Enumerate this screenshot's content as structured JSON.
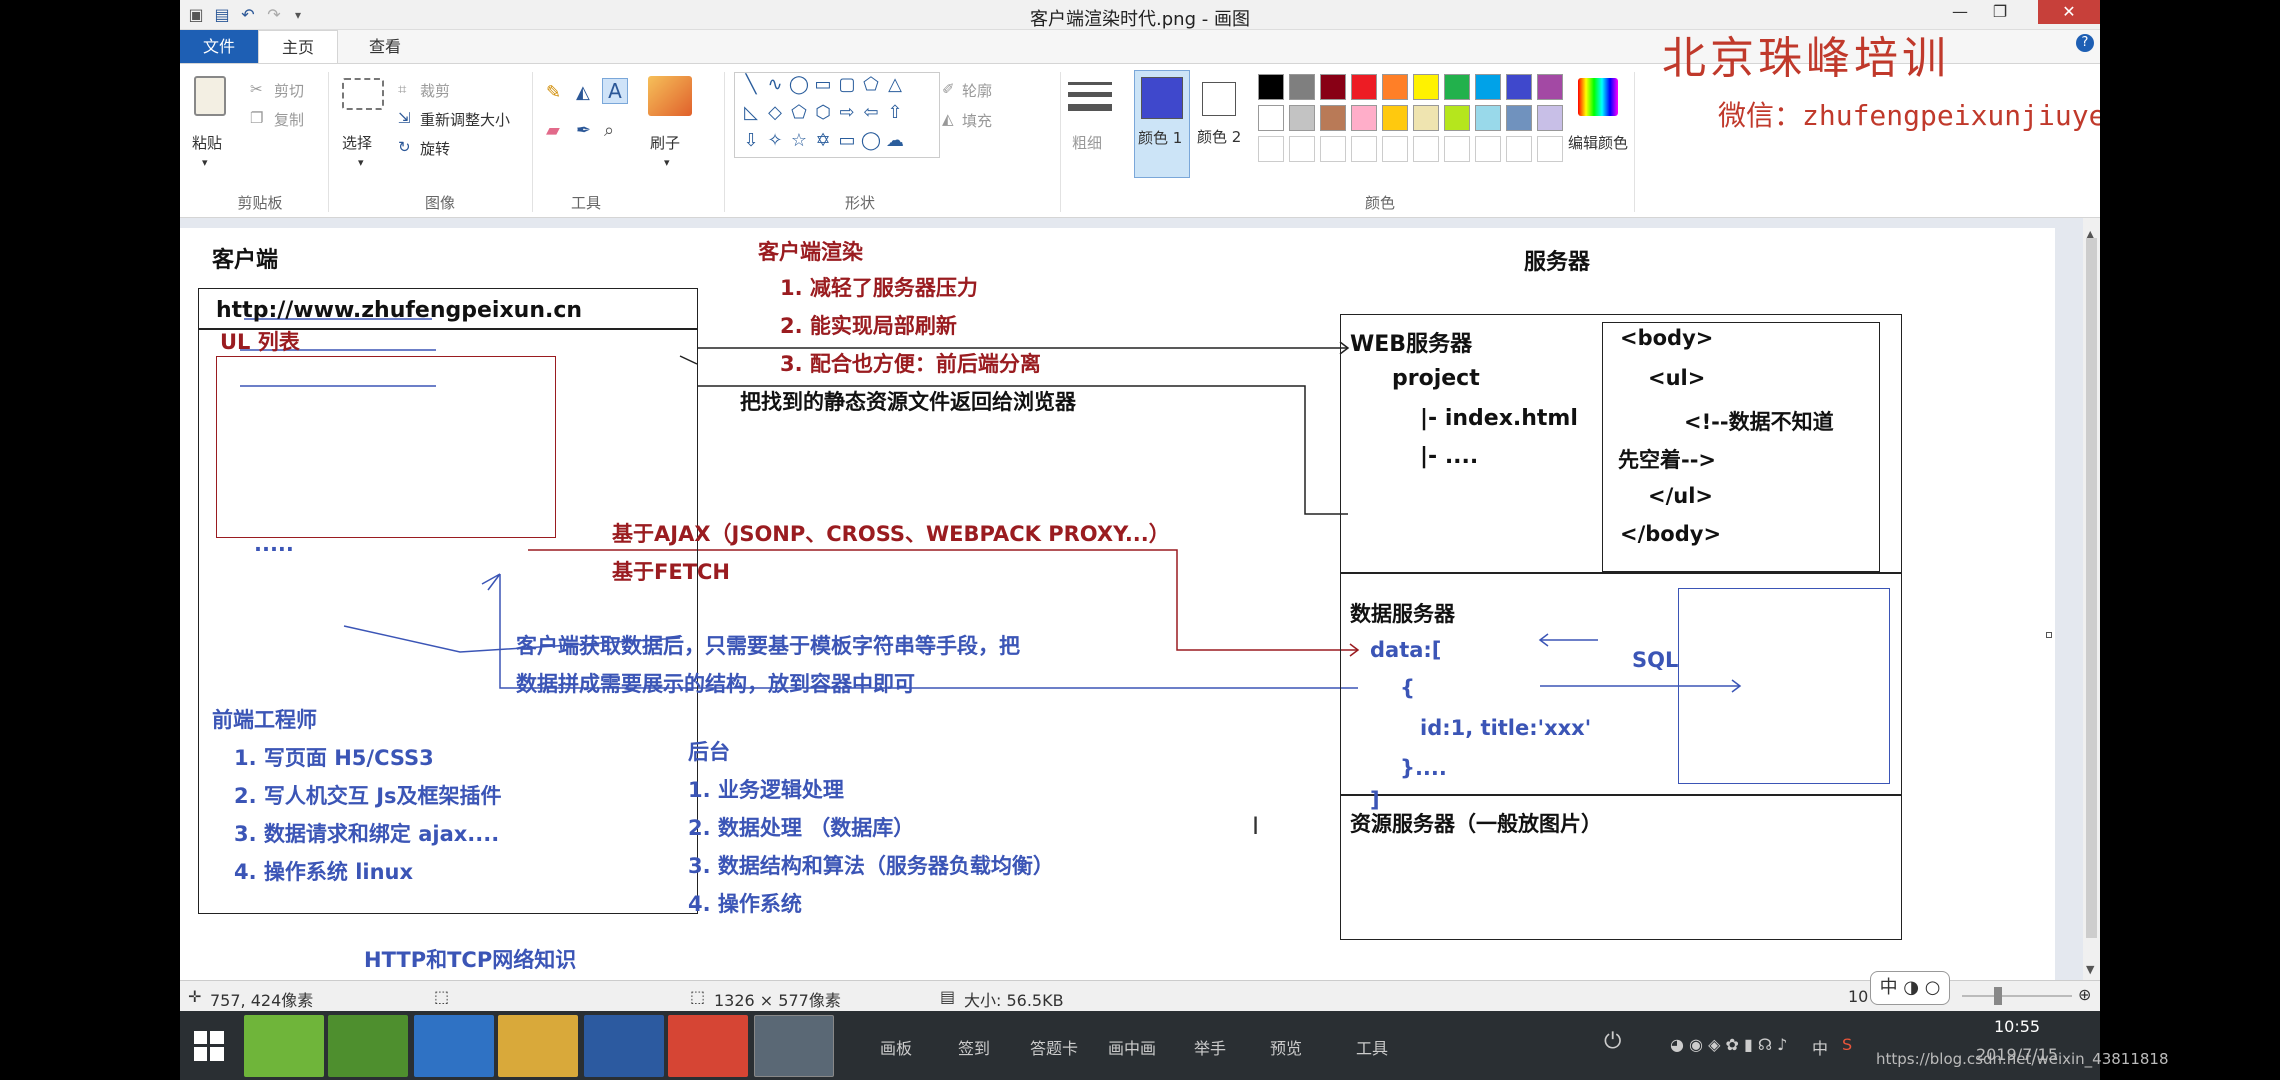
{
  "titlebar": {
    "title": "客户端渲染时代.png - 画图"
  },
  "tabs": {
    "file": "文件",
    "home": "主页",
    "view": "查看"
  },
  "ribbon": {
    "paste": "粘贴",
    "cut": "剪切",
    "copy": "复制",
    "clipboard": "剪贴板",
    "select": "选择",
    "crop": "裁剪",
    "resize": "重新调整大小",
    "rotate": "旋转",
    "image": "图像",
    "tools": "工具",
    "brush": "刷子",
    "outline": "轮廓",
    "fill": "填充",
    "shapes": "形状",
    "size": "粗细",
    "color1": "颜色 1",
    "color2": "颜色 2",
    "edit_colors": "编辑颜色",
    "colors": "颜色",
    "palette_row1": [
      "#000000",
      "#7f7f7f",
      "#880015",
      "#ed1c24",
      "#ff7f27",
      "#fff200",
      "#22b14c",
      "#00a2e8",
      "#3f48cc",
      "#a349a4"
    ],
    "palette_row2": [
      "#ffffff",
      "#c3c3c3",
      "#b97a57",
      "#ffaec9",
      "#ffc90e",
      "#efe4b0",
      "#b5e61d",
      "#99d9ea",
      "#7092be",
      "#c8bfe7"
    ],
    "color1_value": "#3f48cc"
  },
  "watermark": {
    "brand": "北京珠峰培训",
    "wechat": "微信：zhufengpeixunjiuye"
  },
  "diagram": {
    "client_title": "客户端",
    "server_title": "服务器",
    "csr_title": "客户端渲染",
    "csr_points": [
      "1. 减轻了服务器压力",
      "2. 能实现局部刷新",
      "3. 配合也方便：前后端分离"
    ],
    "url": "http://www.zhufengpeixun.cn",
    "ul_list": "UL 列表",
    "return_static": "把找到的静态资源文件返回给浏览器",
    "ellipsis": ".....",
    "ajax": "基于AJAX（JSONP、CROSS、WEBPACK PROXY...）",
    "fetch": "基于FETCH",
    "client_fetch_1": "客户端获取数据后，只需要基于模板字符串等手段，把",
    "client_fetch_2": "数据拼成需要展示的结构，放到容器中即可",
    "fe_title": "前端工程师",
    "fe_items": [
      "1. 写页面 H5/CSS3",
      "2. 写人机交互  Js及框架插件",
      "3. 数据请求和绑定 ajax....",
      "4. 操作系统 linux"
    ],
    "be_title": "后台",
    "be_items": [
      "1. 业务逻辑处理",
      "2. 数据处理 （数据库）",
      "3. 数据结构和算法（服务器负载均衡）",
      "4. 操作系统"
    ],
    "http": "HTTP和TCP网络知识",
    "web_server": "WEB服务器",
    "project": "project",
    "index_html": "|- index.html",
    "dots": "|- ....",
    "html_code": [
      "<body>",
      "<ul>",
      "<!--数据不知道",
      "先空着-->",
      "</ul>",
      "</body>"
    ],
    "data_server": "数据服务器",
    "data_code": [
      "data:[",
      "{",
      "id:1, title:'xxx'",
      "}....",
      "]"
    ],
    "sql": "SQL",
    "resource_server": "资源服务器（一般放图片）"
  },
  "statusbar": {
    "cursor": "757, 424像素",
    "dimensions": "1326 × 577像素",
    "size": "大小: 56.5KB",
    "zoom": "10"
  },
  "taskbar": {
    "items": [
      "画板",
      "签到",
      "答题卡",
      "画中画",
      "举手",
      "预览",
      "工具"
    ],
    "ime": "中",
    "time": "10:55",
    "date": "2019/7/15",
    "url_watermark": "https://blog.csdn.net/weixin_43811818",
    "zoom_ctrl": "中"
  }
}
